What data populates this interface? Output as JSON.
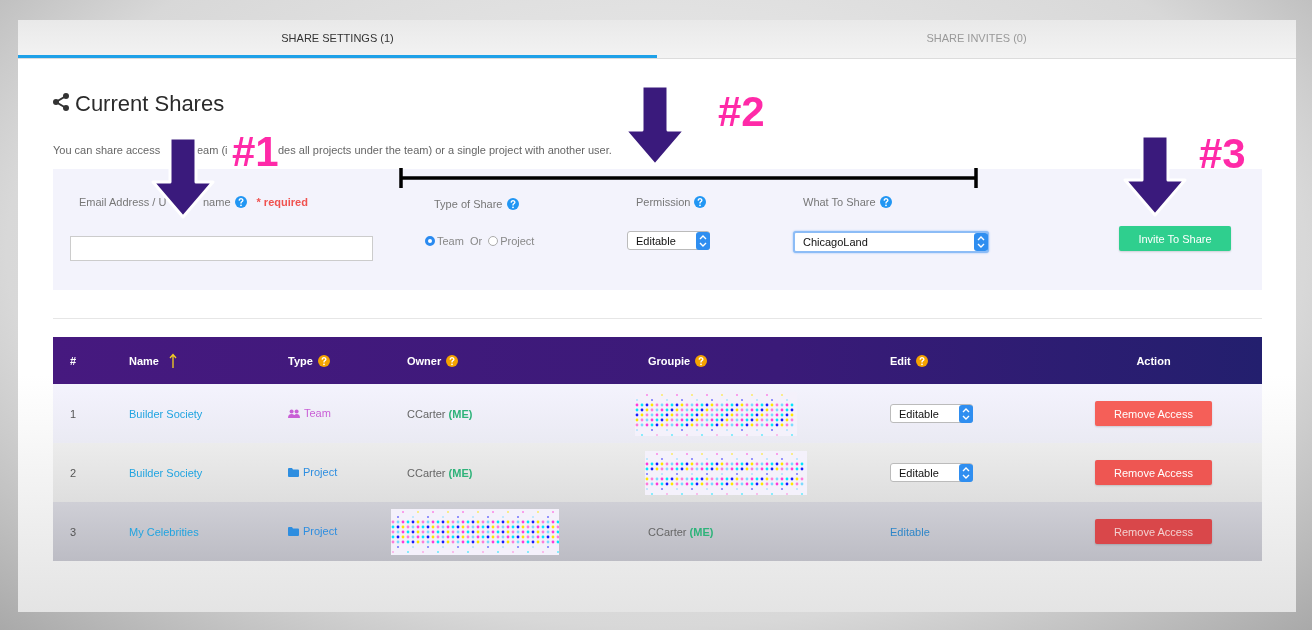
{
  "tabs": [
    {
      "label": "SHARE SETTINGS (1)",
      "selected": true
    },
    {
      "label": "SHARE INVITES (0)",
      "selected": false
    }
  ],
  "heading": "Current Shares",
  "description": [
    "You can share access",
    "eam (i",
    "des all projects under the team) or a single project with another user."
  ],
  "form": {
    "email": {
      "label": [
        "Email Address / U",
        "name"
      ],
      "required": "* required"
    },
    "share_type": {
      "label": "Type of Share",
      "options": [
        {
          "label": "Team",
          "selected": true
        },
        {
          "label": "Project",
          "selected": false
        }
      ],
      "separator": "Or"
    },
    "permission": {
      "label": "Permission",
      "value": "Editable"
    },
    "what_to_share": {
      "label": "What To Share",
      "value": "ChicagoLand"
    },
    "submit": "Invite To Share"
  },
  "table": {
    "columns": [
      {
        "label": "#"
      },
      {
        "label": "Name",
        "sorted": true
      },
      {
        "label": "Type",
        "help": true
      },
      {
        "label": "Owner",
        "help": true
      },
      {
        "label": "Groupie",
        "help": true
      },
      {
        "label": "Edit",
        "help": true
      },
      {
        "label": "Action"
      }
    ],
    "rows": [
      {
        "number": "1",
        "name": "Builder Society",
        "type": {
          "kind": "team",
          "label": "Team"
        },
        "owner": {
          "kind": "user",
          "name": "CCarter",
          "tag": "(ME)"
        },
        "groupie": {
          "kind": "redacted"
        },
        "edit": {
          "kind": "select",
          "value": "Editable"
        },
        "action": "Remove Access"
      },
      {
        "number": "2",
        "name": "Builder Society",
        "type": {
          "kind": "project",
          "label": "Project"
        },
        "owner": {
          "kind": "user",
          "name": "CCarter",
          "tag": "(ME)"
        },
        "groupie": {
          "kind": "redacted"
        },
        "edit": {
          "kind": "select",
          "value": "Editable"
        },
        "action": "Remove Access"
      },
      {
        "number": "3",
        "name": "My Celebrities",
        "type": {
          "kind": "project",
          "label": "Project"
        },
        "owner": {
          "kind": "redacted"
        },
        "groupie": {
          "kind": "user",
          "name": "CCarter",
          "tag": "(ME)"
        },
        "edit": {
          "kind": "link",
          "value": "Editable"
        },
        "action": "Remove Access"
      }
    ]
  },
  "annotations": [
    {
      "label": "#1"
    },
    {
      "label": "#2",
      "bracket": true
    },
    {
      "label": "#3"
    }
  ]
}
